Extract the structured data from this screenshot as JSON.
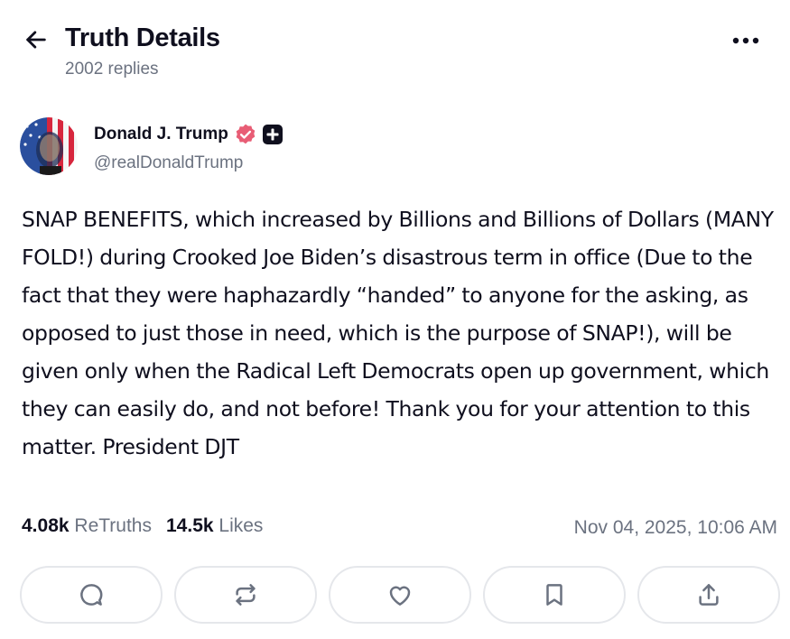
{
  "header": {
    "title": "Truth Details",
    "replies": "2002 replies",
    "back_icon": "arrow-left-icon",
    "more_icon": "ellipsis-icon"
  },
  "author": {
    "name": "Donald J. Trump",
    "handle": "@realDonaldTrump",
    "verified_icon": "verified-badge-icon",
    "plus_icon": "plus-badge-icon",
    "verified_color": "#e85d75"
  },
  "post": {
    "text": "SNAP BENEFITS, which increased by Billions and Billions of Dollars (MANY FOLD!) during Crooked Joe Biden’s disastrous term in office (Due to the fact that they were haphazardly “handed” to anyone for the asking, as opposed to just those in need, which is the purpose of SNAP!), will be given only when the Radical Left Democrats open up government, which they can easily do, and not before! Thank you for your attention to this matter. President DJT"
  },
  "stats": {
    "retruths_count": "4.08k",
    "retruths_label": "ReTruths",
    "likes_count": "14.5k",
    "likes_label": "Likes",
    "timestamp": "Nov 04, 2025, 10:06 AM"
  },
  "actions": [
    {
      "icon": "reply-icon"
    },
    {
      "icon": "retruth-icon"
    },
    {
      "icon": "like-icon"
    },
    {
      "icon": "bookmark-icon"
    },
    {
      "icon": "share-icon"
    }
  ],
  "colors": {
    "text": "#0f0f1e",
    "muted": "#6b7280",
    "border": "#e5e7eb"
  }
}
